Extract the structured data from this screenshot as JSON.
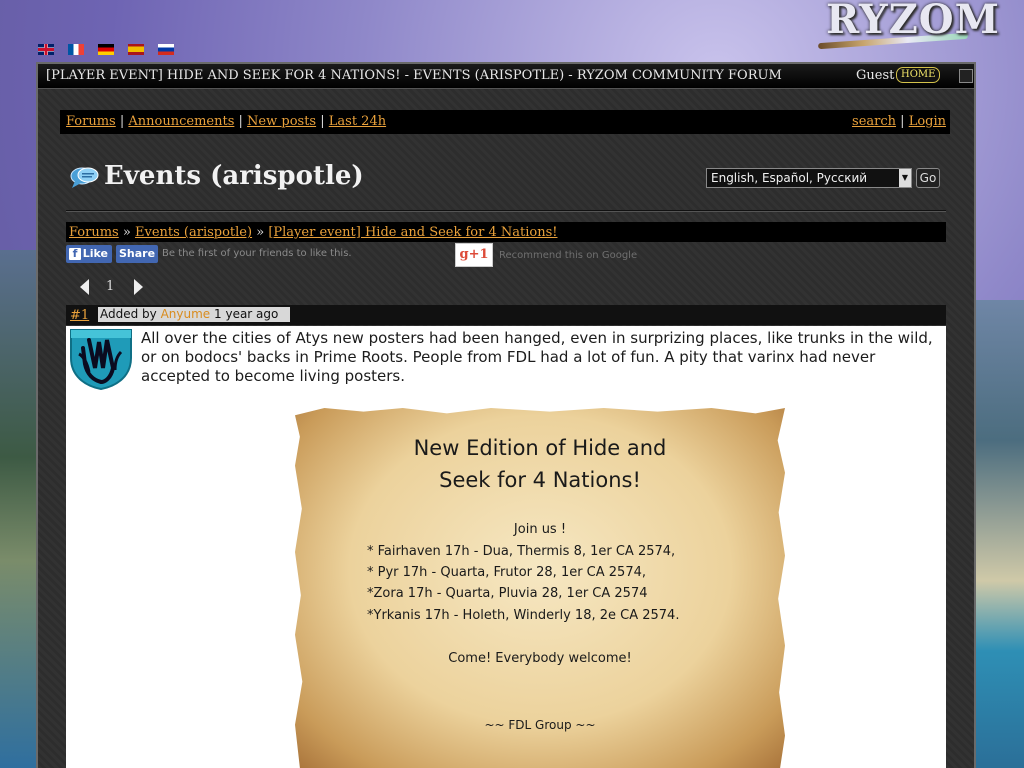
{
  "languages": [
    {
      "code": "en",
      "icon": "uk-flag-icon"
    },
    {
      "code": "fr",
      "icon": "france-flag-icon"
    },
    {
      "code": "de",
      "icon": "germany-flag-icon"
    },
    {
      "code": "es",
      "icon": "spain-flag-icon"
    },
    {
      "code": "ru",
      "icon": "russia-flag-icon"
    }
  ],
  "logo": {
    "text": "RYZOM"
  },
  "window": {
    "title": "[PLAYER EVENT] HIDE AND SEEK FOR 4 NATIONS! - EVENTS (ARISPOTLE) - RYZOM COMMUNITY FORUM",
    "user": "Guest",
    "home_label": "HOME"
  },
  "nav": {
    "forums": "Forums",
    "announcements": "Announcements",
    "new_posts": "New posts",
    "last_24h": "Last 24h",
    "search": "search",
    "login": "Login",
    "separator": "|"
  },
  "forum": {
    "heading": "Events (arispotle)",
    "language_selected": "English, Español, Русский",
    "go_label": "Go"
  },
  "breadcrumb": {
    "forums": "Forums",
    "category": "Events (arispotle)",
    "thread": "[Player event] Hide and Seek for 4 Nations!",
    "separator": "»"
  },
  "social": {
    "like_label": "Like",
    "share_label": "Share",
    "fb_text": "Be the first of your friends to like this.",
    "gplus_label": "g+1",
    "gplus_text": "Recommend this on Google"
  },
  "pager": {
    "current_page": "1"
  },
  "post": {
    "number": "#1",
    "added_by": "Added by",
    "author": "Anyume",
    "age": "1 year ago",
    "text": "All over the cities of Atys new posters had been hanged, even in surprizing places, like trunks in the wild, or on bodocs' backs in Prime Roots. People from FDL had a lot of fun. A pity that varinx had never accepted to become living posters.",
    "poster": {
      "title_line1": "New Edition of Hide and",
      "title_line2": "Seek for 4 Nations!",
      "join": "Join us !",
      "line1": "* Fairhaven 17h - Dua, Thermis 8, 1er CA 2574,",
      "line2": "* Pyr 17h - Quarta, Frutor 28, 1er CA 2574,",
      "line3": "*Zora 17h - Quarta, Pluvia 28, 1er CA 2574",
      "line4": "*Yrkanis 17h - Holeth, Winderly 18, 2e CA 2574.",
      "welcome": "Come! Everybody welcome!",
      "signature": "~~ FDL Group ~~"
    }
  },
  "colors": {
    "link": "#e9a13b",
    "frame_bg": "#2e2e2e",
    "fb_blue": "#4267b2",
    "gplus_red": "#dd4b39"
  }
}
